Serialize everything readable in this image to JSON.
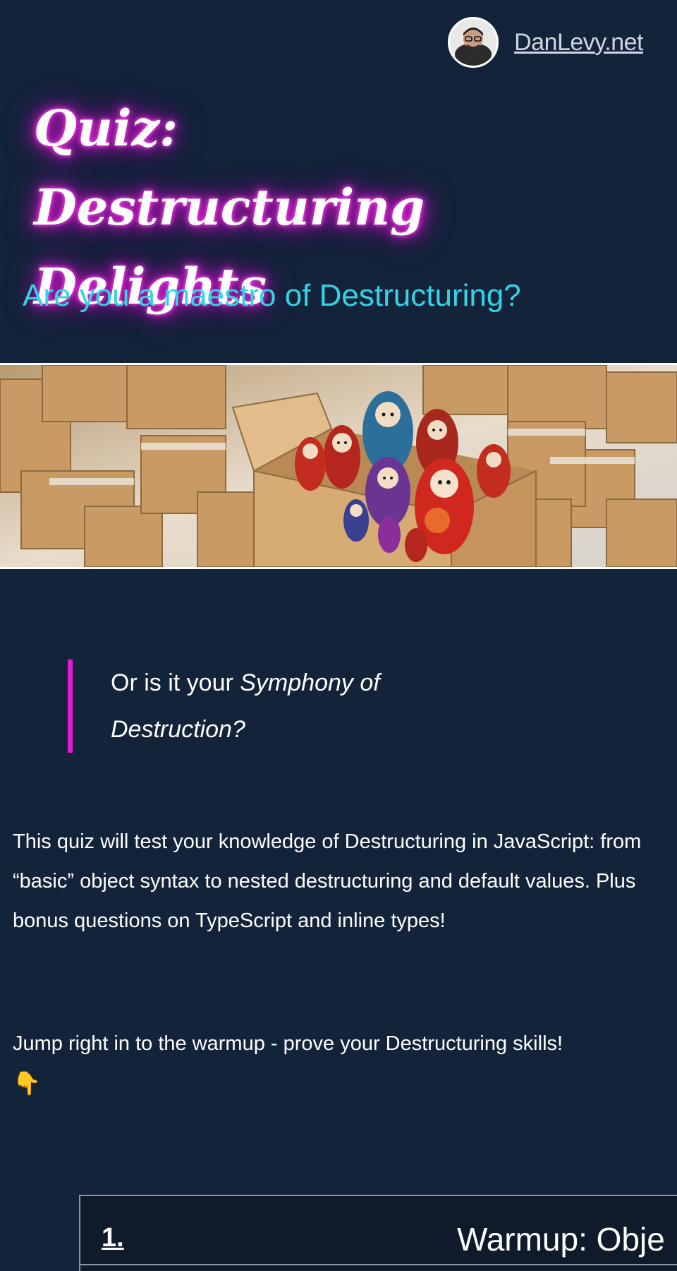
{
  "header": {
    "site_name": "DanLevy.net",
    "avatar_icon": "avatar-photo"
  },
  "hero": {
    "title": "Quiz: Destructuring Delights",
    "subtitle": "Are you a maestro of Destructuring?",
    "image_icon": "nesting-dolls-in-boxes-illustration"
  },
  "quote": {
    "prefix": "Or is it your ",
    "emphasis": "Symphony of Destruction?"
  },
  "intro": {
    "paragraph1": "This quiz will test your knowledge of Destructuring in JavaScript: from “basic” object syntax to nested destructuring and default values. Plus bonus questions on TypeScript and inline types!",
    "paragraph2": "Jump right in to the warmup - prove your Destructuring skills!",
    "pointing_emoji": "👇"
  },
  "question": {
    "number": "1.",
    "title": "Warmup: Obje"
  },
  "colors": {
    "background": "#13233a",
    "title_glow": "#e21bd6",
    "subtitle": "#33d3e6",
    "quote_border": "#e21bd6"
  }
}
